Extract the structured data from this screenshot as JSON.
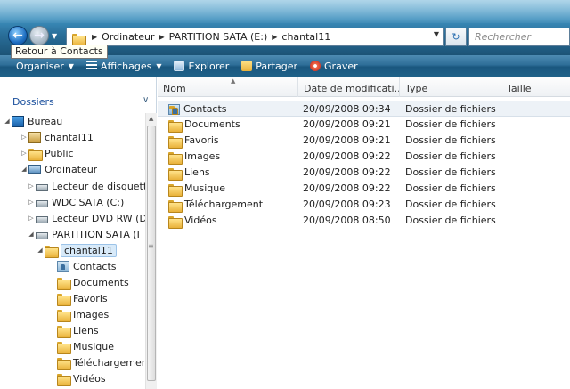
{
  "window": {
    "back_tooltip": "Retour à Contacts"
  },
  "address": {
    "crumbs": [
      "Ordinateur",
      "PARTITION SATA (E:)",
      "chantal11"
    ],
    "search_placeholder": "Rechercher"
  },
  "toolbar": {
    "organize": "Organiser",
    "views": "Affichages",
    "explore": "Explorer",
    "share": "Partager",
    "burn": "Graver"
  },
  "sidebar": {
    "header": "Dossiers",
    "items": [
      {
        "label": "Bureau",
        "icon": "desktop-icon",
        "exp": "◢"
      },
      {
        "label": "chantal11",
        "icon": "user-folder-icon",
        "exp": "▷"
      },
      {
        "label": "Public",
        "icon": "folder-icon",
        "exp": "▷"
      },
      {
        "label": "Ordinateur",
        "icon": "computer-icon",
        "exp": "◢"
      },
      {
        "label": "Lecteur de disquett",
        "icon": "floppy-drive-icon",
        "exp": "▷"
      },
      {
        "label": "WDC SATA (C:)",
        "icon": "hard-drive-icon",
        "exp": "▷"
      },
      {
        "label": "Lecteur DVD RW (D",
        "icon": "dvd-drive-icon",
        "exp": "▷"
      },
      {
        "label": "PARTITION SATA (I",
        "icon": "hard-drive-icon",
        "exp": "◢"
      },
      {
        "label": "chantal11",
        "icon": "folder-icon",
        "exp": "◢"
      },
      {
        "label": "Contacts",
        "icon": "contacts-icon",
        "exp": ""
      },
      {
        "label": "Documents",
        "icon": "folder-icon",
        "exp": ""
      },
      {
        "label": "Favoris",
        "icon": "folder-icon",
        "exp": ""
      },
      {
        "label": "Images",
        "icon": "folder-icon",
        "exp": ""
      },
      {
        "label": "Liens",
        "icon": "folder-icon",
        "exp": ""
      },
      {
        "label": "Musique",
        "icon": "folder-icon",
        "exp": ""
      },
      {
        "label": "Téléchargemen",
        "icon": "folder-icon",
        "exp": ""
      },
      {
        "label": "Vidéos",
        "icon": "folder-icon",
        "exp": ""
      }
    ]
  },
  "columns": {
    "name": "Nom",
    "date": "Date de modificati...",
    "type": "Type",
    "size": "Taille"
  },
  "files": [
    {
      "name": "Contacts",
      "date": "20/09/2008 09:34",
      "type": "Dossier de fichiers",
      "icon": "contacts-icon"
    },
    {
      "name": "Documents",
      "date": "20/09/2008 09:21",
      "type": "Dossier de fichiers",
      "icon": "folder-icon"
    },
    {
      "name": "Favoris",
      "date": "20/09/2008 09:21",
      "type": "Dossier de fichiers",
      "icon": "folder-icon"
    },
    {
      "name": "Images",
      "date": "20/09/2008 09:22",
      "type": "Dossier de fichiers",
      "icon": "folder-icon"
    },
    {
      "name": "Liens",
      "date": "20/09/2008 09:22",
      "type": "Dossier de fichiers",
      "icon": "folder-icon"
    },
    {
      "name": "Musique",
      "date": "20/09/2008 09:22",
      "type": "Dossier de fichiers",
      "icon": "folder-icon"
    },
    {
      "name": "Téléchargement",
      "date": "20/09/2008 09:23",
      "type": "Dossier de fichiers",
      "icon": "folder-icon"
    },
    {
      "name": "Vidéos",
      "date": "20/09/2008 08:50",
      "type": "Dossier de fichiers",
      "icon": "folder-icon"
    }
  ]
}
